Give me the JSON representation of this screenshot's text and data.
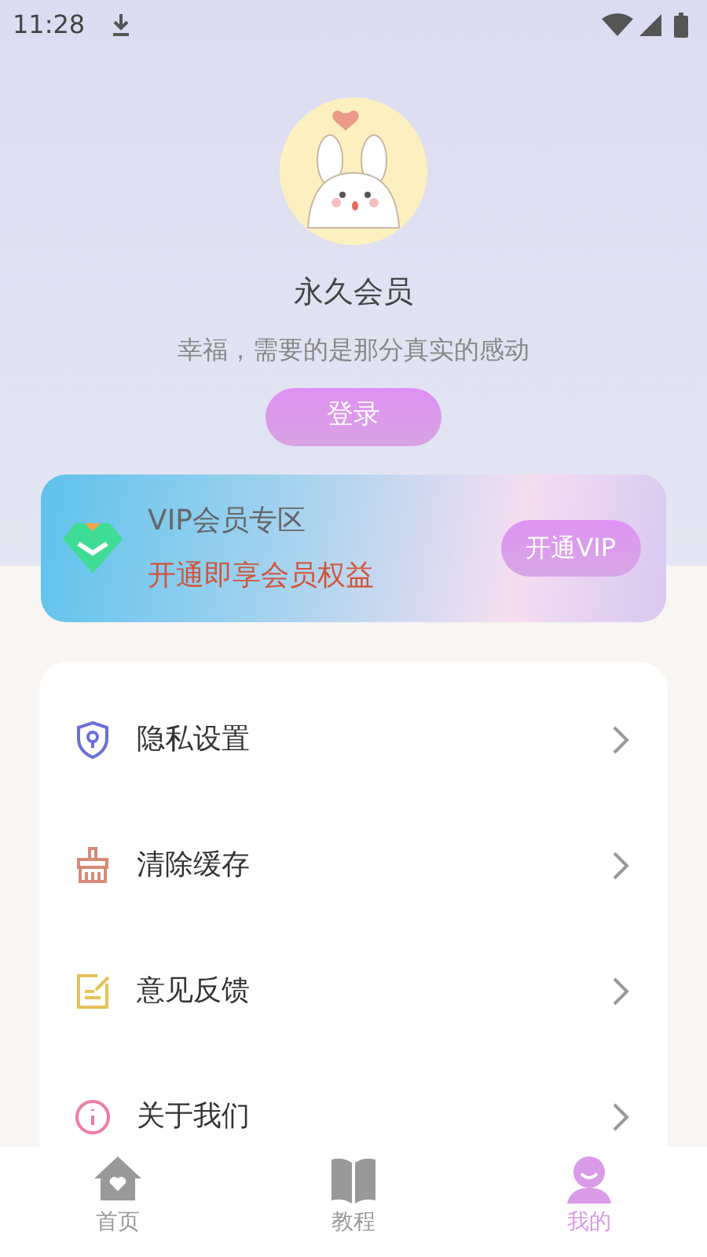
{
  "status_bar": {
    "time": "11:28"
  },
  "profile": {
    "name": "永久会员",
    "motto": "幸福，需要的是那分真实的感动",
    "login_button": "登录"
  },
  "vip": {
    "title": "VIP会员专区",
    "subtitle": "开通即享会员权益",
    "button": "开通VIP"
  },
  "menu": [
    {
      "kind": "privacy",
      "label": "隐私设置"
    },
    {
      "kind": "cache",
      "label": "清除缓存"
    },
    {
      "kind": "feedback",
      "label": "意见反馈"
    },
    {
      "kind": "about",
      "label": "关于我们"
    }
  ],
  "tabs": [
    {
      "kind": "home",
      "label": "首页",
      "selected": false
    },
    {
      "kind": "book",
      "label": "教程",
      "selected": false
    },
    {
      "kind": "user",
      "label": "我的",
      "selected": true
    }
  ]
}
